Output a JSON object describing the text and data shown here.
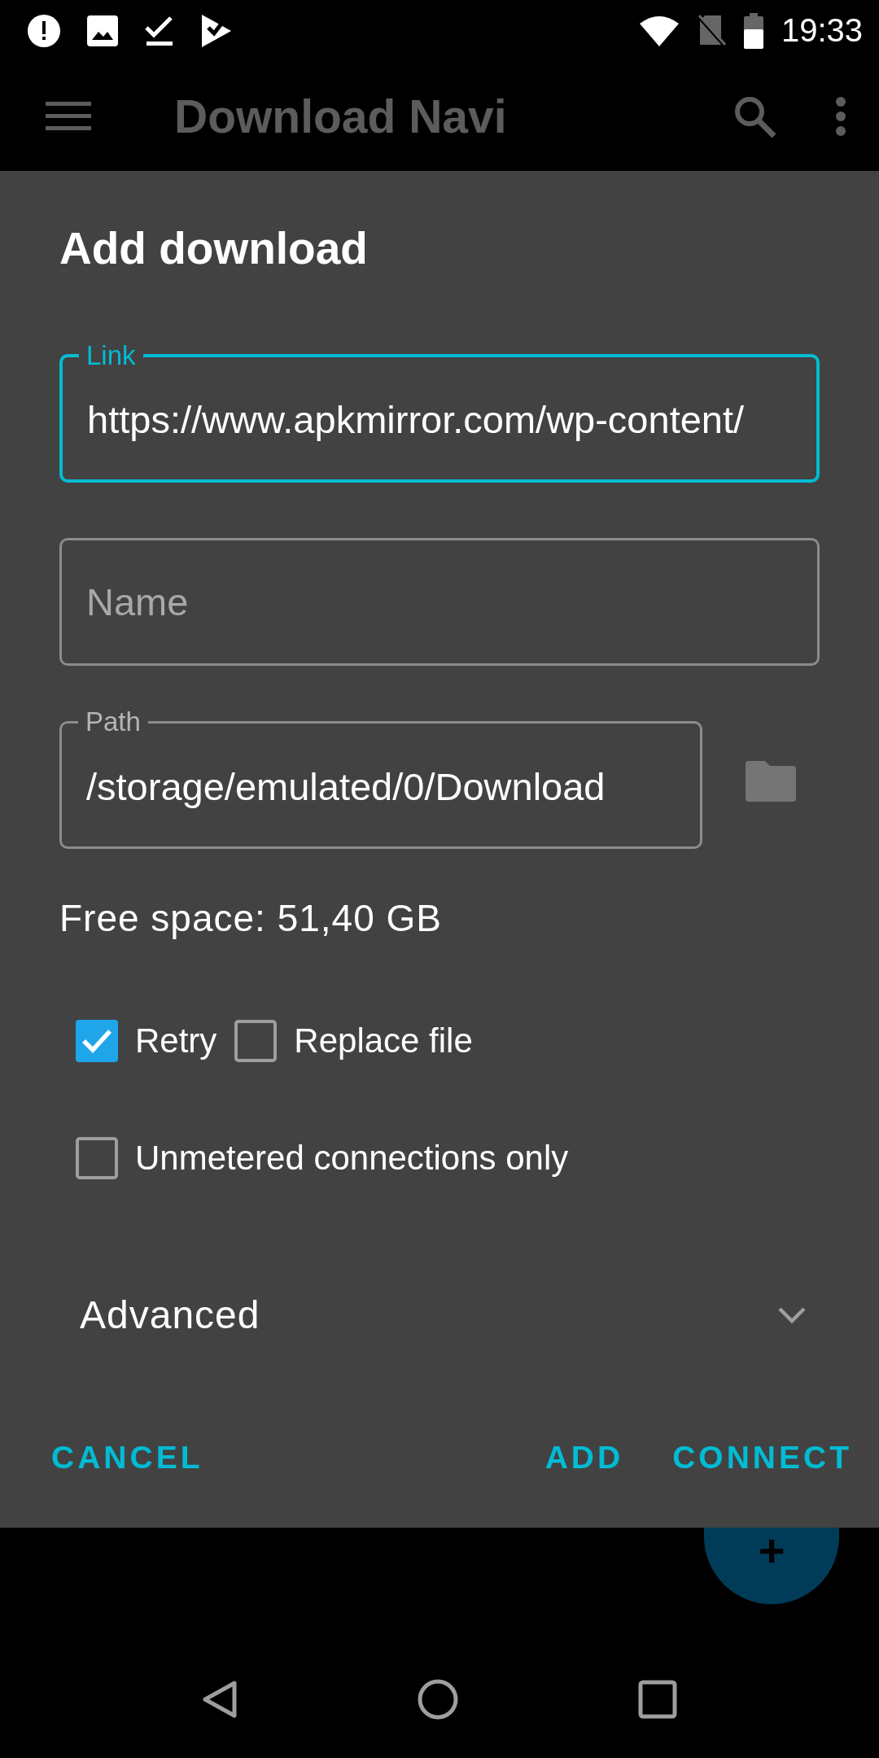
{
  "status_bar": {
    "time": "19:33"
  },
  "toolbar": {
    "title": "Download Navi"
  },
  "dialog": {
    "title": "Add download",
    "fields": [
      {
        "label": "Link",
        "value": "https://www.apkmirror.com/wp-content/",
        "focused": true,
        "folder_button": false
      },
      {
        "placeholder": "Name",
        "focused": false,
        "folder_button": false
      },
      {
        "label": "Path",
        "value": "/storage/emulated/0/Download",
        "focused": false,
        "folder_button": true
      }
    ],
    "free_space": "Free space: 51,40 GB",
    "checkbox_rows": [
      [
        {
          "label": "Retry",
          "checked": true
        },
        {
          "label": "Replace file",
          "checked": false
        }
      ],
      [
        {
          "label": "Unmetered connections only",
          "checked": false
        }
      ]
    ],
    "advanced": {
      "label": "Advanced",
      "expanded": false
    },
    "left_buttons": [
      "CANCEL"
    ],
    "right_buttons": [
      "ADD",
      "CONNECT"
    ]
  },
  "fab": {
    "label": "+"
  }
}
